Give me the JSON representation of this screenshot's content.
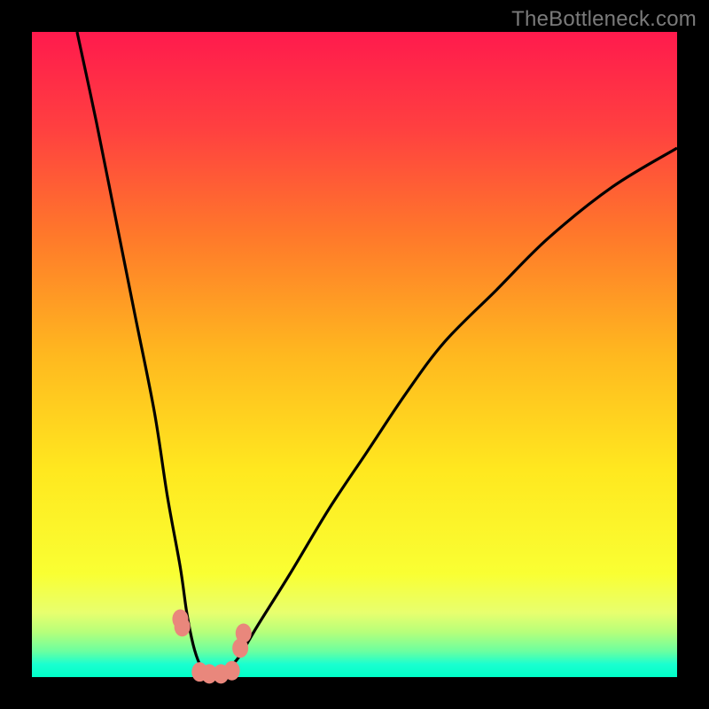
{
  "watermark": "TheBottleneck.com",
  "chart_data": {
    "type": "line",
    "title": "",
    "xlabel": "",
    "ylabel": "",
    "xlim": [
      0,
      100
    ],
    "ylim": [
      0,
      100
    ],
    "grid": false,
    "legend": false,
    "background_gradient": {
      "top": "#ff1a4d",
      "middle": "#ffe81f",
      "bottom": "#00ffc8"
    },
    "series": [
      {
        "name": "bottleneck-curve",
        "color": "#000000",
        "x": [
          7,
          10,
          13,
          16,
          19,
          21,
          23,
          24,
          25,
          26,
          27,
          28,
          29,
          30,
          32,
          35,
          40,
          46,
          52,
          58,
          64,
          72,
          80,
          90,
          100
        ],
        "values": [
          100,
          86,
          71,
          56,
          41,
          28,
          17,
          10,
          5,
          2,
          0.5,
          0,
          0,
          1,
          3,
          8,
          16,
          26,
          35,
          44,
          52,
          60,
          68,
          76,
          82
        ]
      }
    ],
    "markers": [
      {
        "name": "marker-a",
        "x": 23.0,
        "y": 9.0,
        "color": "#e9877c"
      },
      {
        "name": "marker-b",
        "x": 23.3,
        "y": 7.8,
        "color": "#e9877c"
      },
      {
        "name": "marker-c",
        "x": 26.0,
        "y": 0.8,
        "color": "#e9877c"
      },
      {
        "name": "marker-d",
        "x": 27.5,
        "y": 0.5,
        "color": "#e9877c"
      },
      {
        "name": "marker-e",
        "x": 29.3,
        "y": 0.5,
        "color": "#e9877c"
      },
      {
        "name": "marker-f",
        "x": 31.0,
        "y": 1.0,
        "color": "#e9877c"
      },
      {
        "name": "marker-g",
        "x": 32.3,
        "y": 4.5,
        "color": "#e9877c"
      },
      {
        "name": "marker-h",
        "x": 32.8,
        "y": 6.8,
        "color": "#e9877c"
      }
    ]
  }
}
